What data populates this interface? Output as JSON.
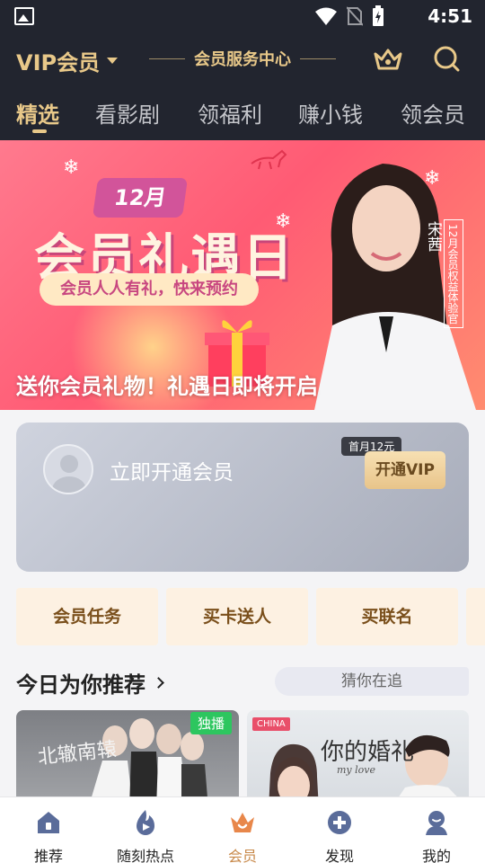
{
  "status_bar": {
    "time": "4:51"
  },
  "header": {
    "title": "VIP会员",
    "service_center": "会员服务中心"
  },
  "tabs": [
    {
      "label": "精选",
      "active": true
    },
    {
      "label": "看影剧",
      "active": false
    },
    {
      "label": "领福利",
      "active": false
    },
    {
      "label": "赚小钱",
      "active": false
    },
    {
      "label": "领会员",
      "active": false
    }
  ],
  "banner": {
    "month_badge": "12月",
    "headline": "会员礼遇日",
    "pill_text": "会员人人有礼，快来预约",
    "star_name": "宋茜",
    "star_role": "12月会员权益体验官",
    "caption": "送你会员礼物！礼遇日即将开启"
  },
  "member_card": {
    "open_text": "立即开通会员",
    "promo_badge": "首月12元",
    "button_label": "开通VIP"
  },
  "quick_actions": [
    {
      "label": "会员任务"
    },
    {
      "label": "买卡送人"
    },
    {
      "label": "买联名"
    }
  ],
  "recommend": {
    "title": "今日为你推荐",
    "guess_pill": "猜你在追",
    "posters": [
      {
        "tag": "独播",
        "title_art": "北辙南辕"
      },
      {
        "logo": "CHINA",
        "title_art": "你的婚礼",
        "subtitle_art": "my love"
      }
    ]
  },
  "bottom_nav": [
    {
      "label": "推荐",
      "icon": "home-icon",
      "active": false
    },
    {
      "label": "随刻热点",
      "icon": "flame-play-icon",
      "active": false
    },
    {
      "label": "会员",
      "icon": "crown-icon",
      "active": true
    },
    {
      "label": "发现",
      "icon": "plus-circle-icon",
      "active": false
    },
    {
      "label": "我的",
      "icon": "profile-icon",
      "active": false
    }
  ],
  "colors": {
    "header_bg": "#22252f",
    "gold": "#e8c889",
    "nav_active": "#c8894a",
    "tag_green": "#2dc65f"
  }
}
